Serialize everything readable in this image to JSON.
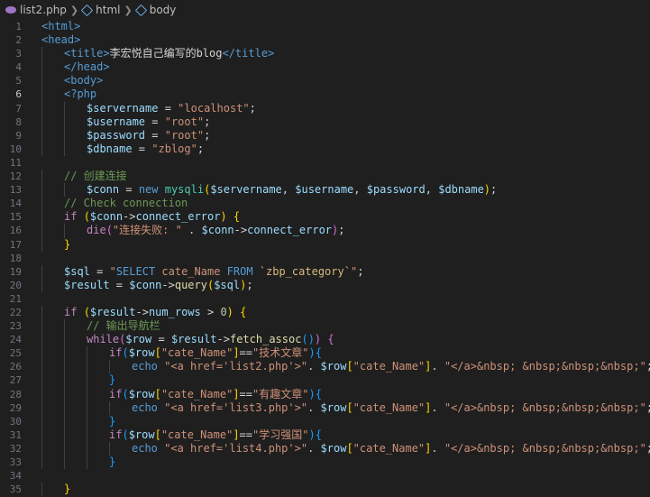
{
  "breadcrumb": {
    "file": "list2.php",
    "items": [
      "html",
      "body"
    ],
    "icons": [
      "php-file-icon",
      "symbol-field-icon",
      "symbol-field-icon"
    ]
  },
  "editor": {
    "active_line": 6,
    "lines": [
      {
        "n": "1",
        "indent": 0,
        "tokens": [
          [
            "t-tag",
            "<html>"
          ]
        ]
      },
      {
        "n": "2",
        "indent": 0,
        "tokens": [
          [
            "t-tag",
            "<head>"
          ]
        ]
      },
      {
        "n": "3",
        "indent": 1,
        "tokens": [
          [
            "t-tag",
            "<title>"
          ],
          [
            "t-txt",
            "李宏悦自己编写的blog"
          ],
          [
            "t-tag",
            "</title>"
          ]
        ]
      },
      {
        "n": "4",
        "indent": 1,
        "tokens": [
          [
            "t-tag",
            "</head>"
          ]
        ]
      },
      {
        "n": "5",
        "indent": 1,
        "tokens": [
          [
            "t-tag",
            "<body>"
          ]
        ]
      },
      {
        "n": "6",
        "indent": 1,
        "tokens": [
          [
            "t-kwb",
            "<?php"
          ]
        ]
      },
      {
        "n": "7",
        "indent": 2,
        "tokens": [
          [
            "t-var",
            "$servername"
          ],
          [
            "t-op",
            " = "
          ],
          [
            "t-str",
            "\"localhost\""
          ],
          [
            "t-op",
            ";"
          ]
        ]
      },
      {
        "n": "8",
        "indent": 2,
        "tokens": [
          [
            "t-var",
            "$username"
          ],
          [
            "t-op",
            " = "
          ],
          [
            "t-str",
            "\"root\""
          ],
          [
            "t-op",
            ";"
          ]
        ]
      },
      {
        "n": "9",
        "indent": 2,
        "tokens": [
          [
            "t-var",
            "$password"
          ],
          [
            "t-op",
            " = "
          ],
          [
            "t-str",
            "\"root\""
          ],
          [
            "t-op",
            ";"
          ]
        ]
      },
      {
        "n": "10",
        "indent": 2,
        "tokens": [
          [
            "t-var",
            "$dbname"
          ],
          [
            "t-op",
            " = "
          ],
          [
            "t-str",
            "\"zblog\""
          ],
          [
            "t-op",
            ";"
          ]
        ]
      },
      {
        "n": "11",
        "indent": 0,
        "tokens": []
      },
      {
        "n": "12",
        "indent": 1,
        "tokens": [
          [
            "t-cm",
            "// 创建连接"
          ]
        ]
      },
      {
        "n": "13",
        "indent": 2,
        "tokens": [
          [
            "t-var",
            "$conn"
          ],
          [
            "t-op",
            " = "
          ],
          [
            "t-kwb",
            "new "
          ],
          [
            "t-cls",
            "mysqli"
          ],
          [
            "t-brace",
            "("
          ],
          [
            "t-var",
            "$servername"
          ],
          [
            "t-op",
            ", "
          ],
          [
            "t-var",
            "$username"
          ],
          [
            "t-op",
            ", "
          ],
          [
            "t-var",
            "$password"
          ],
          [
            "t-op",
            ", "
          ],
          [
            "t-var",
            "$dbname"
          ],
          [
            "t-brace",
            ")"
          ],
          [
            "t-op",
            ";"
          ]
        ]
      },
      {
        "n": "14",
        "indent": 1,
        "tokens": [
          [
            "t-cm",
            "// Check connection"
          ]
        ]
      },
      {
        "n": "15",
        "indent": 1,
        "tokens": [
          [
            "t-kw",
            "if "
          ],
          [
            "t-brace",
            "("
          ],
          [
            "t-var",
            "$conn"
          ],
          [
            "t-op",
            "->"
          ],
          [
            "t-var",
            "connect_error"
          ],
          [
            "t-brace",
            ")"
          ],
          [
            "t-op",
            " "
          ],
          [
            "t-brace",
            "{"
          ]
        ]
      },
      {
        "n": "16",
        "indent": 2,
        "tokens": [
          [
            "t-kw",
            "die"
          ],
          [
            "t-brace2",
            "("
          ],
          [
            "t-str",
            "\"连接失败: \""
          ],
          [
            "t-op",
            " . "
          ],
          [
            "t-var",
            "$conn"
          ],
          [
            "t-op",
            "->"
          ],
          [
            "t-var",
            "connect_error"
          ],
          [
            "t-brace2",
            ")"
          ],
          [
            "t-op",
            ";"
          ]
        ]
      },
      {
        "n": "17",
        "indent": 1,
        "tokens": [
          [
            "t-brace",
            "}"
          ]
        ]
      },
      {
        "n": "18",
        "indent": 0,
        "tokens": []
      },
      {
        "n": "19",
        "indent": 1,
        "tokens": [
          [
            "t-var",
            "$sql"
          ],
          [
            "t-op",
            " = "
          ],
          [
            "t-str",
            "\""
          ],
          [
            "t-kwb",
            "SELECT"
          ],
          [
            "t-str",
            " cate_Name "
          ],
          [
            "t-kwb",
            "FROM"
          ],
          [
            "t-str",
            " "
          ],
          [
            "t-sq",
            "`zbp_category`"
          ],
          [
            "t-str",
            "\""
          ],
          [
            "t-op",
            ";"
          ]
        ]
      },
      {
        "n": "20",
        "indent": 1,
        "tokens": [
          [
            "t-var",
            "$result"
          ],
          [
            "t-op",
            " = "
          ],
          [
            "t-var",
            "$conn"
          ],
          [
            "t-op",
            "->"
          ],
          [
            "t-fn",
            "query"
          ],
          [
            "t-brace",
            "("
          ],
          [
            "t-var",
            "$sql"
          ],
          [
            "t-brace",
            ")"
          ],
          [
            "t-op",
            ";"
          ]
        ]
      },
      {
        "n": "21",
        "indent": 0,
        "tokens": []
      },
      {
        "n": "22",
        "indent": 1,
        "tokens": [
          [
            "t-kw",
            "if "
          ],
          [
            "t-brace",
            "("
          ],
          [
            "t-var",
            "$result"
          ],
          [
            "t-op",
            "->"
          ],
          [
            "t-var",
            "num_rows"
          ],
          [
            "t-op",
            " > "
          ],
          [
            "t-num",
            "0"
          ],
          [
            "t-brace",
            ")"
          ],
          [
            "t-op",
            " "
          ],
          [
            "t-brace",
            "{"
          ]
        ]
      },
      {
        "n": "23",
        "indent": 2,
        "tokens": [
          [
            "t-cm",
            "// 输出导航栏"
          ]
        ]
      },
      {
        "n": "24",
        "indent": 2,
        "tokens": [
          [
            "t-kw",
            "while"
          ],
          [
            "t-brace2",
            "("
          ],
          [
            "t-var",
            "$row"
          ],
          [
            "t-op",
            " = "
          ],
          [
            "t-var",
            "$result"
          ],
          [
            "t-op",
            "->"
          ],
          [
            "t-fn",
            "fetch_assoc"
          ],
          [
            "t-brace3",
            "()"
          ],
          [
            "t-brace2",
            ")"
          ],
          [
            "t-op",
            " "
          ],
          [
            "t-brace2",
            "{"
          ]
        ]
      },
      {
        "n": "25",
        "indent": 3,
        "tokens": [
          [
            "t-kw",
            "if"
          ],
          [
            "t-brace3",
            "("
          ],
          [
            "t-var",
            "$row"
          ],
          [
            "t-brace",
            "["
          ],
          [
            "t-str",
            "\"cate_Name\""
          ],
          [
            "t-brace",
            "]"
          ],
          [
            "t-op",
            "=="
          ],
          [
            "t-str",
            "\"技术文章\""
          ],
          [
            "t-brace3",
            ")"
          ],
          [
            "t-brace3",
            "{"
          ]
        ]
      },
      {
        "n": "26",
        "indent": 4,
        "tokens": [
          [
            "t-kwb",
            "echo "
          ],
          [
            "t-str",
            "\"<a href='list2.php'>\""
          ],
          [
            "t-op",
            ". "
          ],
          [
            "t-var",
            "$row"
          ],
          [
            "t-brace",
            "["
          ],
          [
            "t-str",
            "\"cate_Name\""
          ],
          [
            "t-brace",
            "]"
          ],
          [
            "t-op",
            ". "
          ],
          [
            "t-str",
            "\"</a>&nbsp; &nbsp;&nbsp;&nbsp;\""
          ],
          [
            "t-op",
            ";"
          ]
        ]
      },
      {
        "n": "27",
        "indent": 3,
        "tokens": [
          [
            "t-brace3",
            "}"
          ]
        ]
      },
      {
        "n": "28",
        "indent": 3,
        "tokens": [
          [
            "t-kw",
            "if"
          ],
          [
            "t-brace3",
            "("
          ],
          [
            "t-var",
            "$row"
          ],
          [
            "t-brace",
            "["
          ],
          [
            "t-str",
            "\"cate_Name\""
          ],
          [
            "t-brace",
            "]"
          ],
          [
            "t-op",
            "=="
          ],
          [
            "t-str",
            "\"有趣文章\""
          ],
          [
            "t-brace3",
            ")"
          ],
          [
            "t-brace3",
            "{"
          ]
        ]
      },
      {
        "n": "29",
        "indent": 4,
        "tokens": [
          [
            "t-kwb",
            "echo "
          ],
          [
            "t-str",
            "\"<a href='list3.php'>\""
          ],
          [
            "t-op",
            ". "
          ],
          [
            "t-var",
            "$row"
          ],
          [
            "t-brace",
            "["
          ],
          [
            "t-str",
            "\"cate_Name\""
          ],
          [
            "t-brace",
            "]"
          ],
          [
            "t-op",
            ". "
          ],
          [
            "t-str",
            "\"</a>&nbsp; &nbsp;&nbsp;&nbsp;\""
          ],
          [
            "t-op",
            ";"
          ]
        ]
      },
      {
        "n": "30",
        "indent": 3,
        "tokens": [
          [
            "t-brace3",
            "}"
          ]
        ]
      },
      {
        "n": "31",
        "indent": 3,
        "tokens": [
          [
            "t-kw",
            "if"
          ],
          [
            "t-brace3",
            "("
          ],
          [
            "t-var",
            "$row"
          ],
          [
            "t-brace",
            "["
          ],
          [
            "t-str",
            "\"cate_Name\""
          ],
          [
            "t-brace",
            "]"
          ],
          [
            "t-op",
            "=="
          ],
          [
            "t-str",
            "\"学习强国\""
          ],
          [
            "t-brace3",
            ")"
          ],
          [
            "t-brace3",
            "{"
          ]
        ]
      },
      {
        "n": "32",
        "indent": 4,
        "tokens": [
          [
            "t-kwb",
            "echo "
          ],
          [
            "t-str",
            "\"<a href='list4.php'>\""
          ],
          [
            "t-op",
            ". "
          ],
          [
            "t-var",
            "$row"
          ],
          [
            "t-brace",
            "["
          ],
          [
            "t-str",
            "\"cate_Name\""
          ],
          [
            "t-brace",
            "]"
          ],
          [
            "t-op",
            ". "
          ],
          [
            "t-str",
            "\"</a>&nbsp; &nbsp;&nbsp;&nbsp;\""
          ],
          [
            "t-op",
            ";"
          ]
        ]
      },
      {
        "n": "33",
        "indent": 3,
        "tokens": [
          [
            "t-brace3",
            "}"
          ]
        ]
      },
      {
        "n": "34",
        "indent": 0,
        "tokens": []
      },
      {
        "n": "35",
        "indent": 1,
        "tokens": [
          [
            "t-brace",
            "}"
          ]
        ]
      }
    ]
  }
}
